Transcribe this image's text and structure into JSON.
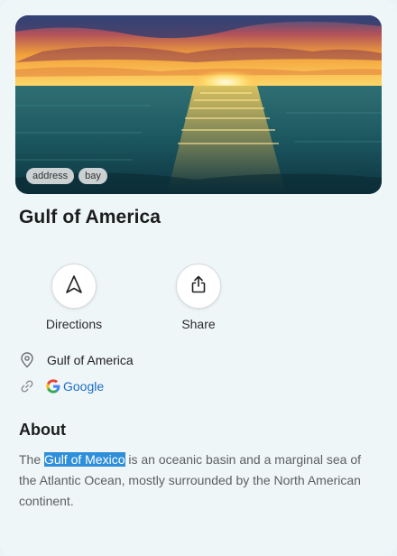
{
  "place": {
    "title": "Gulf of America",
    "tags": [
      "address",
      "bay"
    ]
  },
  "actions": {
    "directions_label": "Directions",
    "share_label": "Share"
  },
  "info": {
    "address": "Gulf of America",
    "link_label": "Google"
  },
  "about": {
    "heading": "About",
    "prefix": "The ",
    "highlight": "Gulf of Mexico",
    "suffix": " is an oceanic basin and a marginal sea of the Atlantic Ocean, mostly surrounded by the North American continent."
  },
  "colors": {
    "highlight_bg": "#2f8fd8",
    "link": "#1a6fc4"
  },
  "icons": {
    "directions": "navigation-arrow-icon",
    "share": "share-icon",
    "address": "location-pin-icon",
    "link": "link-icon",
    "google": "google-logo-icon"
  }
}
